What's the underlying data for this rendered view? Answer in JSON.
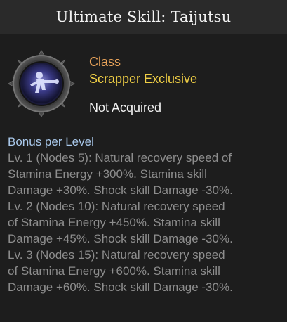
{
  "title": "Ultimate Skill: Taijutsu",
  "icon": "taijutsu-fighter-icon",
  "info": {
    "class_label": "Class",
    "class_value": "Scrapper Exclusive",
    "status": "Not Acquired"
  },
  "bonus": {
    "header": "Bonus per Level",
    "lines": [
      "Lv. 1 (Nodes 5): Natural recovery speed of",
      "Stamina Energy +300%. Stamina skill",
      "Damage +30%. Shock skill Damage -30%.",
      "Lv. 2 (Nodes 10): Natural recovery speed",
      "of Stamina Energy +450%. Stamina skill",
      "Damage +45%. Shock skill Damage -30%.",
      "Lv. 3 (Nodes 15): Natural recovery speed",
      "of Stamina Energy +600%. Stamina skill",
      "Damage +60%. Shock skill Damage -30%."
    ]
  },
  "colors": {
    "title_bg": "#2a2a2a",
    "panel_bg": "#1d1d1d",
    "class_label": "#e8a35a",
    "class_value": "#f0cf45",
    "bonus_header": "#a9c8ea",
    "bonus_text": "#8d8d8d"
  }
}
